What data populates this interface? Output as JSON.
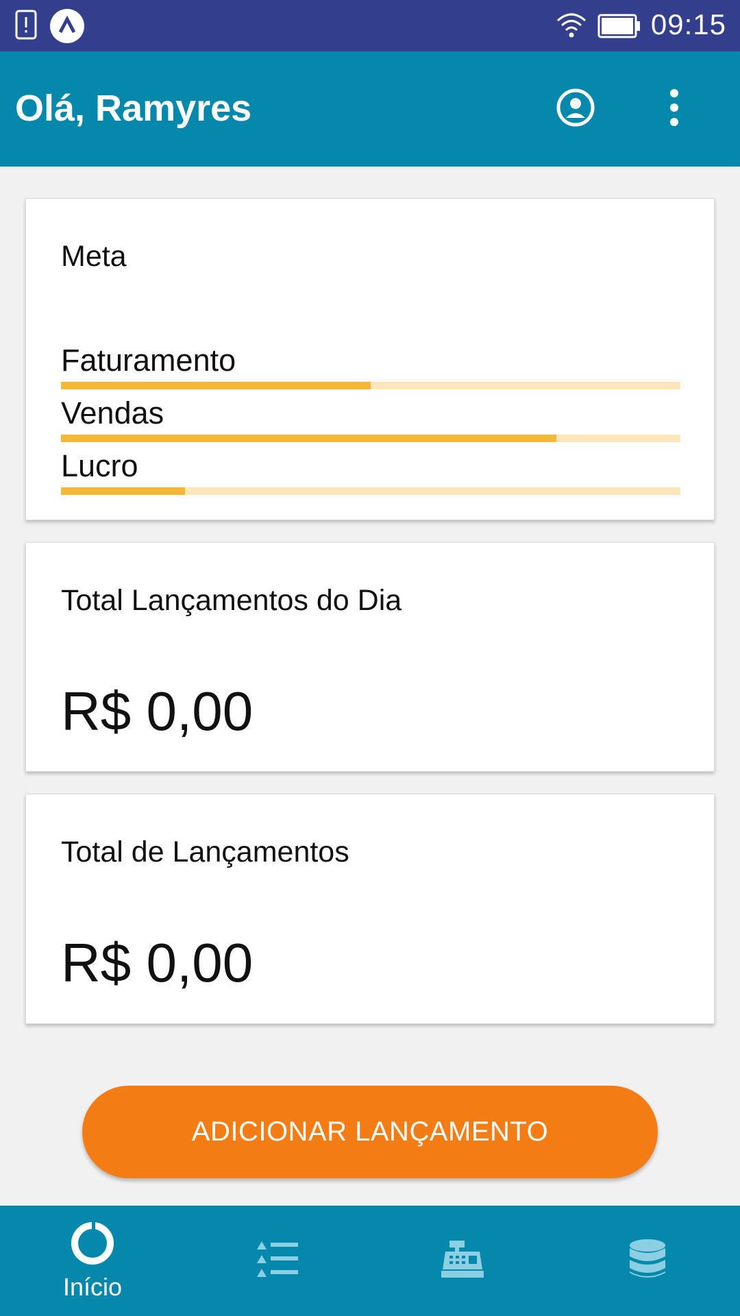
{
  "status_bar": {
    "time": "09:15",
    "icons": [
      "alert-notification-icon",
      "app-notification-icon",
      "wifi-icon",
      "battery-icon"
    ]
  },
  "app_bar": {
    "greeting": "Olá, Ramyres",
    "icons": [
      "account-circle-icon",
      "more-vert-icon"
    ],
    "color": "#0688ad"
  },
  "goal_card": {
    "title": "Meta",
    "goals": [
      {
        "label": "Faturamento",
        "progress": 0.5
      },
      {
        "label": "Vendas",
        "progress": 0.8
      },
      {
        "label": "Lucro",
        "progress": 0.2
      }
    ],
    "fill_color": "#f6b736",
    "track_color": "#fde6bb"
  },
  "daily_total_card": {
    "title": "Total Lançamentos do Dia",
    "amount": "R$ 0,00"
  },
  "total_card": {
    "title": "Total de Lançamentos",
    "amount": "R$ 0,00"
  },
  "add_button": {
    "label": "ADICIONAR LANÇAMENTO",
    "color": "#f47c14"
  },
  "bottom_nav": {
    "items": [
      {
        "label": "Início",
        "icon": "home-donut-icon",
        "active": true
      },
      {
        "label": "",
        "icon": "list-icon",
        "active": false
      },
      {
        "label": "",
        "icon": "cash-register-icon",
        "active": false
      },
      {
        "label": "",
        "icon": "database-icon",
        "active": false
      }
    ],
    "active_color": "#ffffff",
    "inactive_color": "#8ccfe2"
  }
}
